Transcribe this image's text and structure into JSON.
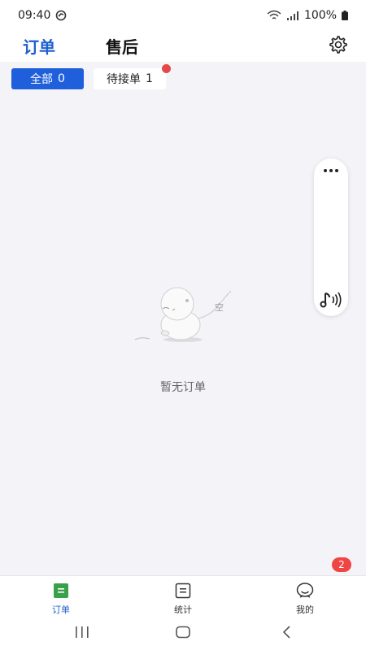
{
  "status_bar": {
    "time": "09:40",
    "battery": "100%"
  },
  "header": {
    "tab_orders": "订单",
    "tab_aftersale": "售后"
  },
  "filters": [
    {
      "label": "全部",
      "count": "0"
    },
    {
      "label": "待接单",
      "count": "1"
    }
  ],
  "empty_state": {
    "bubble_text": "空",
    "message": "暂无订单"
  },
  "badge": {
    "count": "2"
  },
  "bottom_nav": [
    {
      "label": "订单"
    },
    {
      "label": "统计"
    },
    {
      "label": "我的"
    }
  ],
  "colors": {
    "accent": "#1f5fcf",
    "chip_active": "#1f5fdc",
    "badge_red": "#ef4545",
    "nav_green": "#3aa04a"
  }
}
